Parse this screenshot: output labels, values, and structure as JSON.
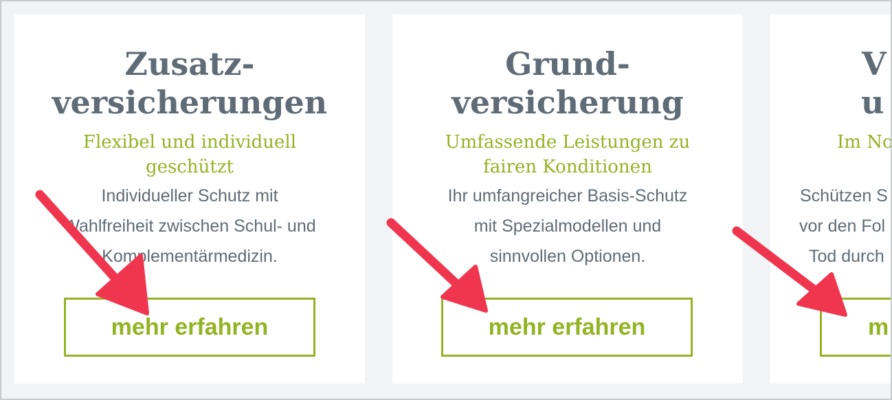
{
  "cards": [
    {
      "title": [
        "Zusatz-",
        "versicherungen"
      ],
      "subtitle": [
        "Flexibel und individuell",
        "geschützt"
      ],
      "description": [
        "Individueller Schutz mit",
        "Wahlfreiheit zwischen Schul- und",
        "Komplementärmedizin."
      ],
      "button_label": "mehr erfahren"
    },
    {
      "title": [
        "Grund-",
        "versicherung"
      ],
      "subtitle": [
        "Umfassende Leistungen zu",
        "fairen Konditionen"
      ],
      "description": [
        "Ihr umfangreicher Basis-Schutz",
        "mit Spezialmodellen und",
        "sinnvollen Optionen."
      ],
      "button_label": "mehr erfahren"
    },
    {
      "title": [
        "V",
        "u"
      ],
      "subtitle": [
        "Im No"
      ],
      "description": [
        "Schützen S",
        "vor den Fol",
        "Tod durch"
      ],
      "button_label": "m"
    }
  ],
  "colors": {
    "accent_green": "#94b323",
    "title_gray": "#5f6c77",
    "arrow_red": "#f0364f",
    "page_bg": "#f2f3f5"
  }
}
